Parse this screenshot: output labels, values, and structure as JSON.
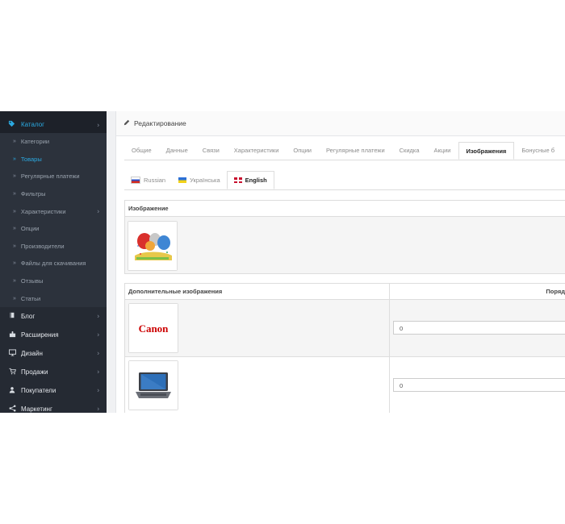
{
  "sidebar": {
    "catalog_label": "Каталог",
    "sub_items": [
      {
        "label": "Категории"
      },
      {
        "label": "Товары"
      },
      {
        "label": "Регулярные платежи"
      },
      {
        "label": "Фильтры"
      },
      {
        "label": "Характеристики"
      },
      {
        "label": "Опции"
      },
      {
        "label": "Производители"
      },
      {
        "label": "Файлы для скачивания"
      },
      {
        "label": "Отзывы"
      },
      {
        "label": "Статьи"
      }
    ],
    "items": [
      {
        "label": "Блог",
        "icon": "book-icon"
      },
      {
        "label": "Расширения",
        "icon": "puzzle-icon"
      },
      {
        "label": "Дизайн",
        "icon": "monitor-icon"
      },
      {
        "label": "Продажи",
        "icon": "cart-icon"
      },
      {
        "label": "Покупатели",
        "icon": "user-icon"
      },
      {
        "label": "Маркетинг",
        "icon": "share-icon"
      }
    ],
    "accent_color": "#2ba9e1"
  },
  "panel": {
    "title": "Редактирование"
  },
  "tabs": [
    {
      "label": "Общие"
    },
    {
      "label": "Данные"
    },
    {
      "label": "Связи"
    },
    {
      "label": "Характеристики"
    },
    {
      "label": "Опции"
    },
    {
      "label": "Регулярные платежи"
    },
    {
      "label": "Скидка"
    },
    {
      "label": "Акции"
    },
    {
      "label": "Изображения"
    },
    {
      "label": "Бонусные б"
    }
  ],
  "active_tab": "Изображения",
  "language_tabs": [
    {
      "label": "Russian"
    },
    {
      "label": "Українська"
    },
    {
      "label": "English"
    }
  ],
  "active_language": "English",
  "image_section": {
    "header": "Изображение"
  },
  "additional_images": {
    "header_image": "Дополнительные изображения",
    "header_sort": "Поряд",
    "rows": [
      {
        "logo_text": "Canon",
        "sort_value": "0"
      },
      {
        "logo_text": "",
        "sort_value": "0"
      }
    ]
  }
}
